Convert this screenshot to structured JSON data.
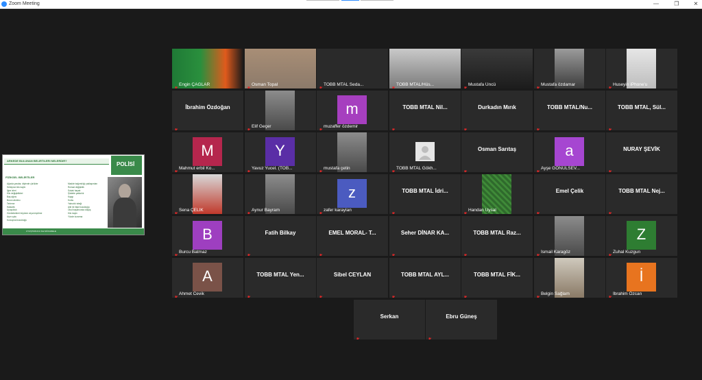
{
  "window": {
    "title": "Zoom Meeting",
    "minimize_icon": "—",
    "restore_icon": "❐",
    "close_icon": "✕"
  },
  "share_panel": {
    "header": "ARKEDE BULUNAN BELIRTILERI NELERDIR?",
    "logo_text": "POLİSİ",
    "section_title": "FİZİKSEL BELİRTİLER",
    "left_items": [
      "Ağızda yaralar, dişlerde çürükler",
      "Sebepsiz kilo kaybı",
      "İğne izleri",
      "Kilo değişiklikleri",
      "Baş ağrısı",
      "Burun akıntısı",
      "Terleme",
      "Halsizlik",
      "Uyuşukluk",
      "Gözbebekleri büyüme veya küçülme",
      "Aşırı uyku",
      "Konuşma bozukluğu"
    ],
    "right_items": [
      "Madde bağımlılığı yaklaşımları",
      "Ruhsal değişiklik",
      "Sokak hayatı",
      "Şiddete yatkınlık",
      "Kaygı",
      "Korku",
      "Yalnızlık isteği",
      "Aile ile ilişki bozukluğu",
      "Okul başarısında düşüş",
      "Kilo kaybı",
      "Yüzde kızarma"
    ],
    "footer": "UYUŞTURUCU İLE MÜCADELE"
  },
  "tiles": [
    {
      "name": "Engin ÇAĞLAR",
      "type": "video",
      "active": true
    },
    {
      "name": "Osman Topal",
      "type": "video"
    },
    {
      "name": "TOBB MTAL Seda...",
      "type": "blank"
    },
    {
      "name": "TOBB MTAL/Hüs...",
      "type": "video"
    },
    {
      "name": "Mustafa Üncü",
      "type": "video"
    },
    {
      "name": "Mustafa özdamar",
      "type": "video"
    },
    {
      "name": "Huseyin iPhone'u",
      "type": "video"
    },
    {
      "center": "İbrahim Özdoğan",
      "type": "name"
    },
    {
      "name": "Elif Geçer",
      "type": "video"
    },
    {
      "name": "muzaffer özdemir",
      "type": "avatar",
      "letter": "m",
      "color": "#a63fbf"
    },
    {
      "center": "TOBB MTAL Nil...",
      "type": "name"
    },
    {
      "center": "Durkadın Mırık",
      "type": "name"
    },
    {
      "center": "TOBB MTAL/Nu...",
      "type": "name"
    },
    {
      "center": "TOBB MTAL, Sül...",
      "type": "name"
    },
    {
      "name": "Mahmut erbil Ko...",
      "type": "avatar",
      "letter": "M",
      "color": "#b5264d"
    },
    {
      "name": "Yavuz Yucel. (TOB...",
      "type": "avatar",
      "letter": "Y",
      "color": "#5a2ea6"
    },
    {
      "name": "mustafa çetin",
      "type": "video"
    },
    {
      "name": "TOBB MTAL Gökh...",
      "type": "profile"
    },
    {
      "center": "Osman Sarıtaş",
      "type": "name"
    },
    {
      "name": "Ayşe GÖNÜLSEV...",
      "type": "avatar",
      "letter": "a",
      "color": "#a646d1"
    },
    {
      "center": "NURAY ŞEVİK",
      "type": "name"
    },
    {
      "name": "Sena ÇELİK",
      "type": "video"
    },
    {
      "name": "Aynur Bayram",
      "type": "video"
    },
    {
      "name": "zafer karaylan",
      "type": "avatar",
      "letter": "z",
      "color": "#4b5bc0"
    },
    {
      "center": "TOBB MTAL İdri...",
      "type": "name"
    },
    {
      "name": "Handan Uysal",
      "type": "video"
    },
    {
      "center": "Emel Çelik",
      "type": "name"
    },
    {
      "center": "TOBB MTAL Nej...",
      "type": "name"
    },
    {
      "name": "Burcu Batmaz",
      "type": "avatar",
      "letter": "B",
      "color": "#9e3fc0"
    },
    {
      "center": "Fatih Bilkay",
      "type": "name"
    },
    {
      "center": "EMEL MORAL- T...",
      "type": "name"
    },
    {
      "center": "Seher DİNAR KA...",
      "type": "name"
    },
    {
      "center": "TOBB MTAL Raz...",
      "type": "name"
    },
    {
      "name": "İsmail Karagöz",
      "type": "video"
    },
    {
      "name": "Zuhal Kuzgun",
      "type": "avatar",
      "letter": "Z",
      "color": "#2e7d32"
    },
    {
      "name": "Ahmet Cevik",
      "type": "avatar",
      "letter": "A",
      "color": "#7a5248"
    },
    {
      "center": "TOBB MTAL Yen...",
      "type": "name"
    },
    {
      "center": "Sibel CEYLAN",
      "type": "name"
    },
    {
      "center": "TOBB MTAL AYL...",
      "type": "name"
    },
    {
      "center": "TOBB MTAL FİK...",
      "type": "name"
    },
    {
      "name": "Belgin Sağlam",
      "type": "video"
    },
    {
      "name": "İbrahim Özcan",
      "type": "avatar",
      "letter": "İ",
      "color": "#e8741f"
    },
    {
      "center": "Serkan",
      "type": "name"
    },
    {
      "center": "Ebru Güneş",
      "type": "name"
    }
  ],
  "icons": {
    "muted_mic": "mic-muted-icon",
    "app": "zoom-icon"
  }
}
